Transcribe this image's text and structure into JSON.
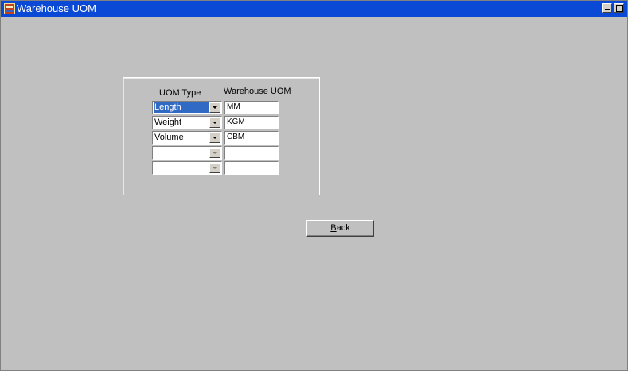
{
  "window": {
    "title": "Warehouse UOM",
    "icon": "app-icon",
    "controls": [
      "minimize-icon",
      "maximize-icon"
    ]
  },
  "form": {
    "headers": {
      "uom_type": "UOM Type",
      "warehouse_uom": "Warehouse UOM"
    },
    "rows": [
      {
        "uom_type": "Length",
        "warehouse_uom": "MM",
        "selected": true,
        "enabled": true
      },
      {
        "uom_type": "Weight",
        "warehouse_uom": "KGM",
        "selected": false,
        "enabled": true
      },
      {
        "uom_type": "Volume",
        "warehouse_uom": "CBM",
        "selected": false,
        "enabled": true
      },
      {
        "uom_type": "",
        "warehouse_uom": "",
        "selected": false,
        "enabled": false
      },
      {
        "uom_type": "",
        "warehouse_uom": "",
        "selected": false,
        "enabled": false
      }
    ]
  },
  "buttons": {
    "back_label_accel": "B",
    "back_label_rest": "ack"
  },
  "colors": {
    "titlebar": "#0a49d6",
    "background": "#c0c0c0",
    "selection": "#316ac5"
  }
}
